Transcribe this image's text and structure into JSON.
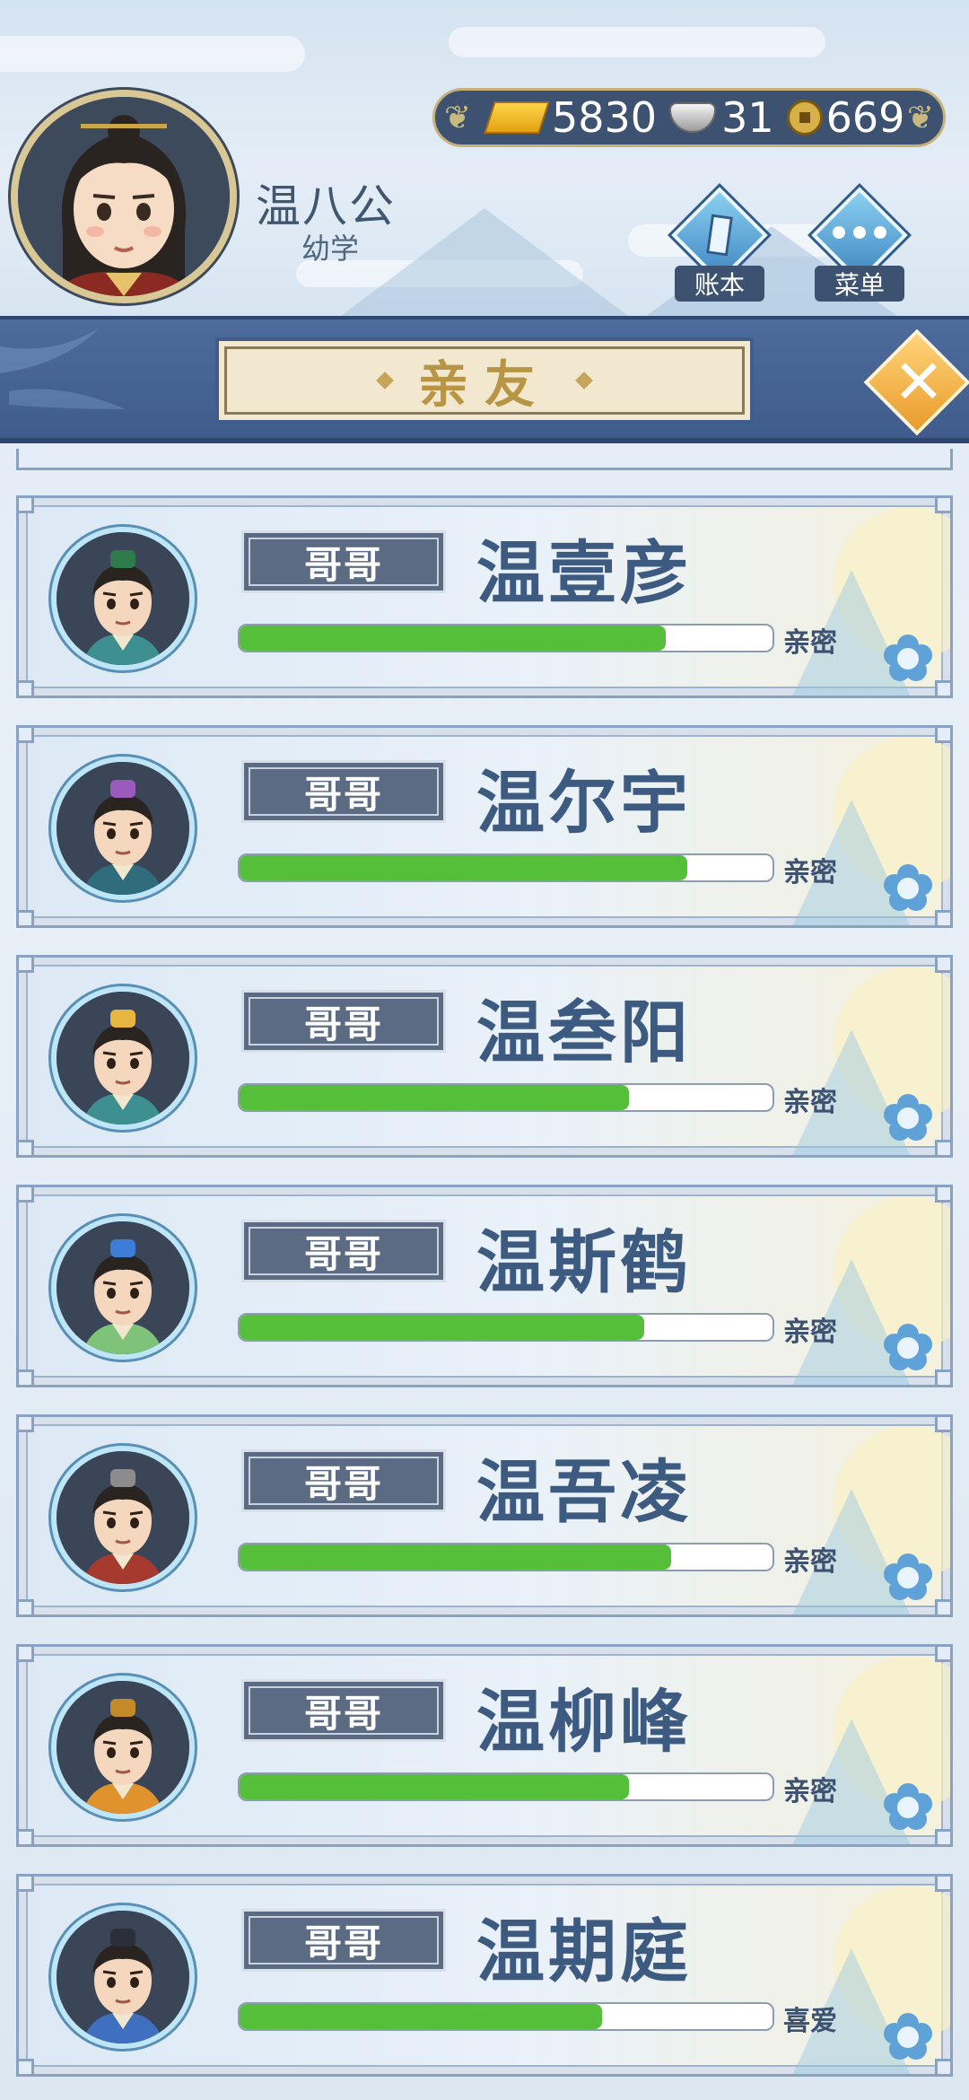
{
  "player": {
    "name": "温八公",
    "rank": "幼学"
  },
  "currency": {
    "gold": "5830",
    "silver": "31",
    "copper": "669"
  },
  "buttons": {
    "ledger_label": "账本",
    "menu_label": "菜单"
  },
  "title": "亲友",
  "friends": [
    {
      "relation": "哥哥",
      "name": "温壹彦",
      "status": "亲密",
      "affinity": 0.8,
      "hat_color": "#2e7a4a",
      "robe_color": "#3e8f8f"
    },
    {
      "relation": "哥哥",
      "name": "温尔宇",
      "status": "亲密",
      "affinity": 0.84,
      "hat_color": "#9b5bbd",
      "robe_color": "#2f6c7c"
    },
    {
      "relation": "哥哥",
      "name": "温叁阳",
      "status": "亲密",
      "affinity": 0.73,
      "hat_color": "#e6b640",
      "robe_color": "#3e8f8f"
    },
    {
      "relation": "哥哥",
      "name": "温斯鹤",
      "status": "亲密",
      "affinity": 0.76,
      "hat_color": "#3d7dd6",
      "robe_color": "#7fc27a"
    },
    {
      "relation": "哥哥",
      "name": "温吾凌",
      "status": "亲密",
      "affinity": 0.81,
      "hat_color": "#8c8c8c",
      "robe_color": "#a73a2e"
    },
    {
      "relation": "哥哥",
      "name": "温柳峰",
      "status": "亲密",
      "affinity": 0.73,
      "hat_color": "#c48a2a",
      "robe_color": "#e0932c"
    },
    {
      "relation": "哥哥",
      "name": "温期庭",
      "status": "喜爱",
      "affinity": 0.68,
      "hat_color": "#2a2f3a",
      "robe_color": "#3f6fbf"
    }
  ]
}
